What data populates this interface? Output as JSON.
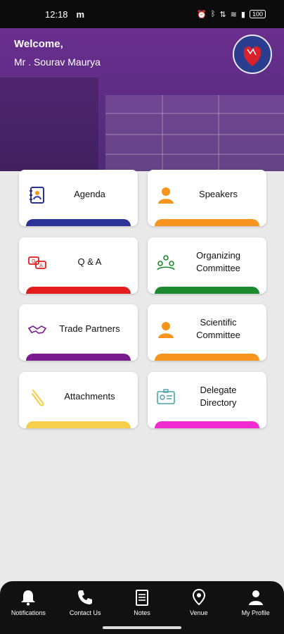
{
  "status": {
    "time": "12:18",
    "carrier_icon": "m",
    "battery": "100",
    "right_icons": [
      "alarm-icon",
      "bluetooth-icon",
      "data-icon",
      "wifi-icon",
      "signal-icon",
      "battery-icon"
    ]
  },
  "header": {
    "welcome": "Welcome,",
    "user": "Mr . Sourav Maurya",
    "logo": "heart-logo"
  },
  "tiles": [
    {
      "label": "Agenda",
      "icon": "agenda-icon",
      "color": "#2b3399"
    },
    {
      "label": "Speakers",
      "icon": "speaker-icon",
      "color": "#f6941e"
    },
    {
      "label": "Q & A",
      "icon": "qa-icon",
      "color": "#e31c1c"
    },
    {
      "label": "Organizing\nCommittee",
      "icon": "committee-icon",
      "color": "#1b8a2e"
    },
    {
      "label": "Trade Partners",
      "icon": "handshake-icon",
      "color": "#7a1a8f"
    },
    {
      "label": "Scientific\nCommittee",
      "icon": "scientific-icon",
      "color": "#f6941e"
    },
    {
      "label": "Attachments",
      "icon": "paperclip-icon",
      "color": "#f6d04d"
    },
    {
      "label": "Delegate\nDirectory",
      "icon": "id-card-icon",
      "color": "#f02bd0"
    }
  ],
  "nav": [
    {
      "label": "Notifications",
      "icon": "bell-icon"
    },
    {
      "label": "Contact Us",
      "icon": "phone-icon"
    },
    {
      "label": "Notes",
      "icon": "notes-icon"
    },
    {
      "label": "Venue",
      "icon": "location-icon"
    },
    {
      "label": "My Profile",
      "icon": "profile-icon"
    }
  ]
}
